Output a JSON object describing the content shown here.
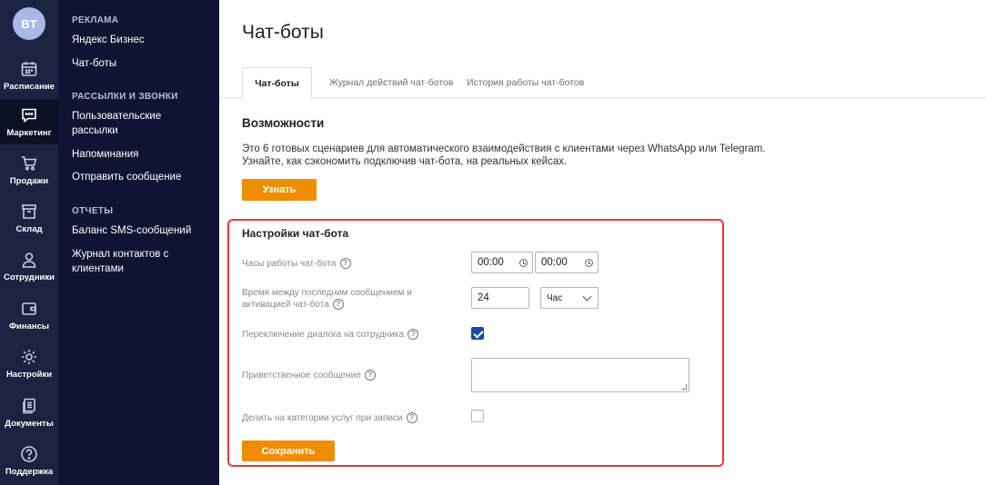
{
  "user": {
    "initials": "BT"
  },
  "rail": [
    {
      "label": "Расписание",
      "icon": "calendar-icon"
    },
    {
      "label": "Маркетинг",
      "icon": "message-icon"
    },
    {
      "label": "Продажи",
      "icon": "cart-icon"
    },
    {
      "label": "Склад",
      "icon": "box-icon"
    },
    {
      "label": "Сотрудники",
      "icon": "person-icon"
    },
    {
      "label": "Финансы",
      "icon": "wallet-icon"
    },
    {
      "label": "Настройки",
      "icon": "gear-icon"
    },
    {
      "label": "Документы",
      "icon": "documents-icon"
    },
    {
      "label": "Поддержка",
      "icon": "help-icon"
    }
  ],
  "subnav": {
    "sections": [
      {
        "title": "РЕКЛАМА",
        "items": [
          "Яндекс Бизнес",
          "Чат-боты"
        ]
      },
      {
        "title": "РАССЫЛКИ И ЗВОНКИ",
        "items": [
          "Пользовательские рассылки",
          "Напоминания",
          "Отправить сообщение"
        ]
      },
      {
        "title": "ОТЧЕТЫ",
        "items": [
          "Баланс SMS-сообщений",
          "Журнал контактов с клиентами"
        ]
      }
    ]
  },
  "page": {
    "title": "Чат-боты",
    "tabs": [
      "Чат-боты",
      "Журнал действий чат-ботов",
      "История работы чат-ботов"
    ],
    "features": {
      "heading": "Возможности",
      "line1": "Это 6 готовых сценариев для автоматического взаимодействия с клиентами через WhatsApp или Telegram.",
      "line2": "Узнайте, как сэкономить подключив чат-бота, на реальных кейсах.",
      "button": "Узнать"
    },
    "settings": {
      "heading": "Настройки чат-бота",
      "hours_label": "Часы работы чат-бота",
      "hours_from": "00:00",
      "hours_to": "00:00",
      "delay_label_1": "Время между последним сообщением и",
      "delay_label_2": "активацией чат-бота",
      "delay_value": "24",
      "delay_unit": "Час",
      "switch_label": "Переключение диалога на сотрудника",
      "switch_checked": true,
      "greeting_label": "Приветственное сообщение",
      "greeting_value": "",
      "categories_label": "Делить на категории услуг при записи",
      "categories_checked": false,
      "help_glyph": "?",
      "save_button": "Сохранить"
    }
  },
  "colors": {
    "rail_bg": "#1c2340",
    "subnav_bg": "#0f1433",
    "accent": "#f08c00",
    "checkbox": "#1a4aa8",
    "highlight": "#e03c3c"
  }
}
